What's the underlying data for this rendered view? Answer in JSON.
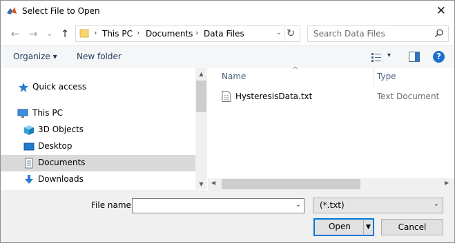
{
  "window": {
    "title": "Select File to Open",
    "close_glyph": "✕"
  },
  "nav": {
    "back_glyph": "←",
    "forward_glyph": "→",
    "recent_glyph": "⌄",
    "up_glyph": "↑",
    "breadcrumbs": [
      "This PC",
      "Documents",
      "Data Files"
    ],
    "crumb_sep": "›",
    "refresh_glyph": "↻",
    "search_placeholder": "Search Data Files"
  },
  "toolbar": {
    "organize_label": "Organize ▾",
    "new_folder_label": "New folder",
    "help_glyph": "?"
  },
  "sidebar": {
    "items": [
      {
        "label": "Quick access",
        "icon": "star-icon"
      },
      {
        "label": "This PC",
        "icon": "computer-icon"
      },
      {
        "label": "3D Objects",
        "icon": "cube-icon"
      },
      {
        "label": "Desktop",
        "icon": "desktop-icon"
      },
      {
        "label": "Documents",
        "icon": "documents-icon",
        "selected": true
      },
      {
        "label": "Downloads",
        "icon": "download-icon"
      }
    ]
  },
  "filelist": {
    "columns": [
      "Name",
      "Type"
    ],
    "files": [
      {
        "name": "HysteresisData.txt",
        "type": "Text Document",
        "icon": "text-file-icon"
      }
    ]
  },
  "footer": {
    "filename_label": "File name:",
    "filename_value": "",
    "filter_value": "(*.txt)",
    "open_label": "Open",
    "cancel_label": "Cancel"
  },
  "colors": {
    "accent": "#0078d7",
    "selected_bg": "#d9d9d9",
    "folder": "#f7d56c",
    "help_blue": "#1a6fd1"
  }
}
